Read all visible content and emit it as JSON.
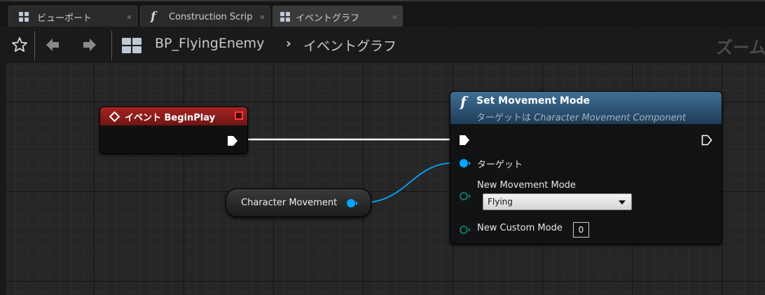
{
  "tabs": [
    {
      "label": "ビューポート",
      "icon": "blueprint-viewport-icon"
    },
    {
      "label": "Construction Scrip",
      "icon": "function-icon"
    },
    {
      "label": "イベントグラフ",
      "icon": "blueprint-graph-icon",
      "active": true
    }
  ],
  "toolbar": {
    "asset_name": "BP_FlyingEnemy",
    "separator": "›",
    "graph_name": "イベントグラフ",
    "zoom_text": "ズーム"
  },
  "nodes": {
    "begin_play": {
      "title": "イベント BeginPlay",
      "header_color": "#a72424"
    },
    "set_movement_mode": {
      "title": "Set Movement Mode",
      "subtitle_prefix": "ターゲットは ",
      "subtitle_target": "Character Movement Component",
      "target_pin_label": "ターゲット",
      "mode_pin_label": "New Movement Mode",
      "mode_value": "Flying",
      "custom_mode_pin_label": "New Custom Mode",
      "custom_mode_value": "0",
      "header_color": "#3f6f95"
    },
    "character_movement": {
      "label": "Character Movement"
    }
  },
  "colors": {
    "object_pin": "#00a8ff",
    "byte_pin": "#0b6e5e",
    "exec_wire": "#ffffff"
  }
}
